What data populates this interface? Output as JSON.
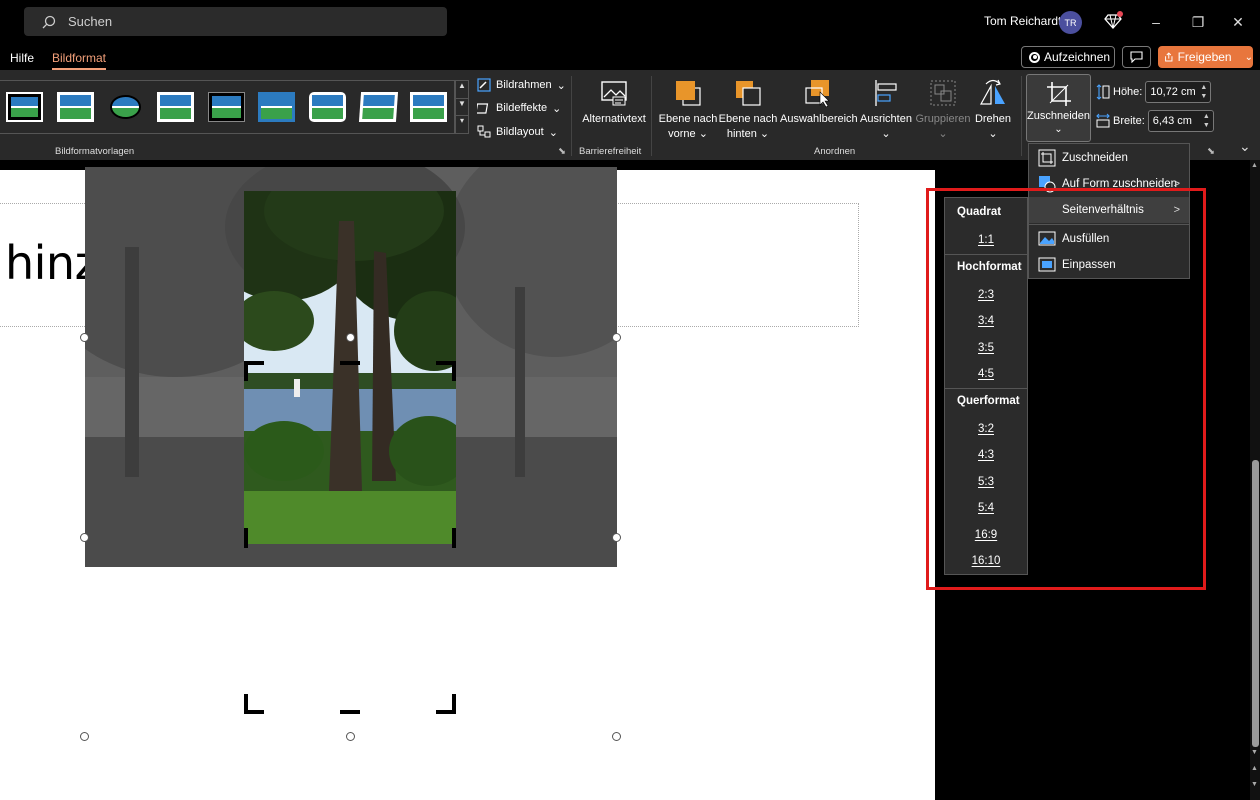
{
  "titlebar": {
    "search_placeholder": "Suchen",
    "user_name": "Tom Reichardt",
    "user_initials": "TR",
    "minimize": "–",
    "restore": "❐",
    "close": "✕"
  },
  "tabs": [
    {
      "label": "Hilfe",
      "active": false
    },
    {
      "label": "Bildformat",
      "active": true
    }
  ],
  "actions": {
    "record_label": "Aufzeichnen",
    "share_label": "Freigeben",
    "share_chevron": "⌄"
  },
  "ribbon": {
    "groups": {
      "styles": "Bildformatvorlagen",
      "accessibility": "Barrierefreiheit",
      "arrange": "Anordnen"
    },
    "picture_border": "Bildrahmen",
    "picture_effects": "Bildeffekte",
    "picture_layout": "Bildlayout",
    "alt_text": "Alternativtext",
    "bring_forward_line1": "Ebene nach",
    "bring_forward_line2": "vorne",
    "send_backward_line1": "Ebene nach",
    "send_backward_line2": "hinten",
    "selection_pane": "Auswahlbereich",
    "align": "Ausrichten",
    "group": "Gruppieren",
    "rotate": "Drehen",
    "crop": "Zuschneiden",
    "height_label": "Höhe:",
    "height_value": "10,72 cm",
    "width_label": "Breite:",
    "width_value": "6,43 cm",
    "spin_up": "▲",
    "spin_down": "▼",
    "chevron": "⌄",
    "launcher": "⬊",
    "collapse": "⌄",
    "gallery_up": "▲",
    "gallery_down": "▼",
    "gallery_more": "▾"
  },
  "slide": {
    "title": "hinzufügen"
  },
  "crop_menu": {
    "items": [
      {
        "label": "Zuschneiden",
        "icon": "crop-icon",
        "has_submenu": false
      },
      {
        "label": "Auf Form zuschneiden",
        "icon": "shape-crop-icon",
        "has_submenu": true
      },
      {
        "label": "Seitenverhältnis",
        "icon": "",
        "has_submenu": true
      },
      {
        "label": "Ausfüllen",
        "icon": "fill-icon",
        "has_submenu": false
      },
      {
        "label": "Einpassen",
        "icon": "fit-icon",
        "has_submenu": false
      }
    ],
    "arrow": ">"
  },
  "aspect_submenu": {
    "square_header": "Quadrat",
    "square": [
      "1:1"
    ],
    "portrait_header": "Hochformat",
    "portrait": [
      "2:3",
      "3:4",
      "3:5",
      "4:5"
    ],
    "landscape_header": "Querformat",
    "landscape": [
      "3:2",
      "4:3",
      "5:3",
      "5:4",
      "16:9",
      "16:10"
    ]
  },
  "colors": {
    "accent": "#f3a07a",
    "share_button": "#e8763d",
    "highlight": "#e01b1b",
    "ribbon_bg": "#292929",
    "arrange_orange": "#e8952a"
  }
}
